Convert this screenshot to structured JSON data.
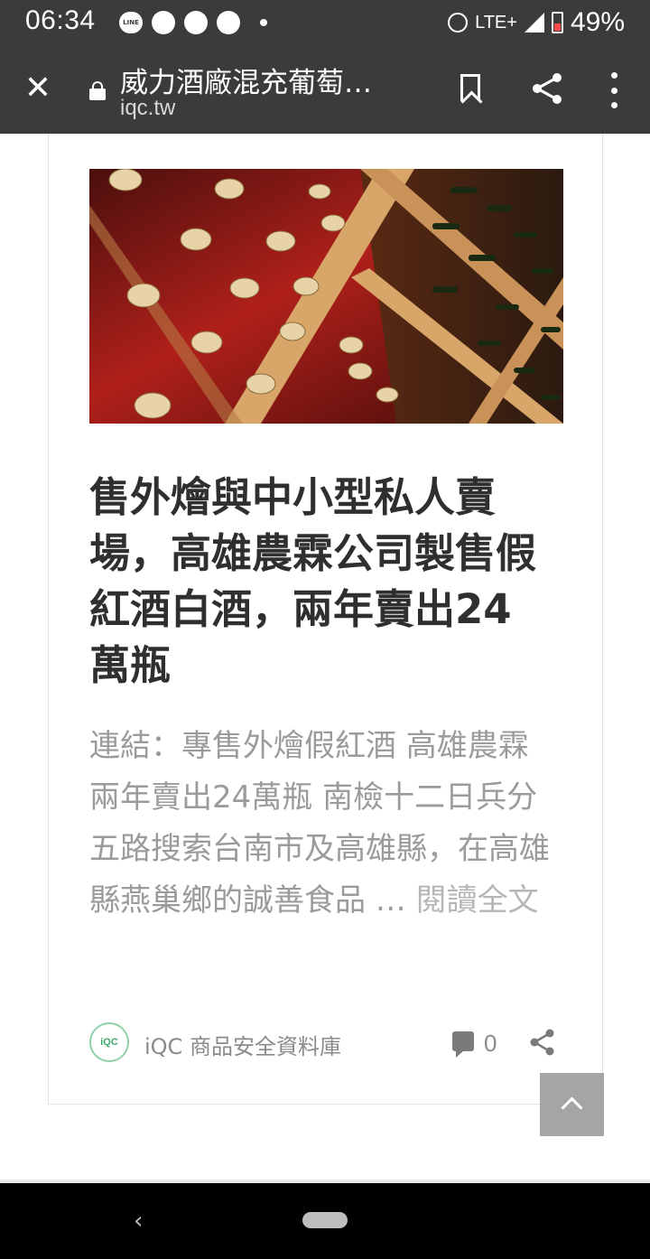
{
  "status_bar": {
    "time": "06:34",
    "network": "LTE+",
    "battery": "49%",
    "icons": [
      "line-icon",
      "circle-icon",
      "reddit-icon",
      "circle-icon",
      "dot-icon",
      "alarm-icon",
      "signal-icon",
      "battery-icon"
    ]
  },
  "toolbar": {
    "title": "威力酒廠混充葡萄…",
    "url": "iqc.tw"
  },
  "article": {
    "title": "售外燴與中小型私人賣場，高雄農霖公司製售假紅酒白酒，兩年賣出24萬瓶",
    "excerpt": "連結：專售外燴假紅酒 高雄農霖兩年賣出24萬瓶 南檢十二日兵分五路搜索台南市及高雄縣，在高雄縣燕巢鄉的誠善食品 … ",
    "read_more": "閱讀全文",
    "author": "iQC 商品安全資料庫",
    "avatar_text": "iQC",
    "comment_count": "0"
  }
}
